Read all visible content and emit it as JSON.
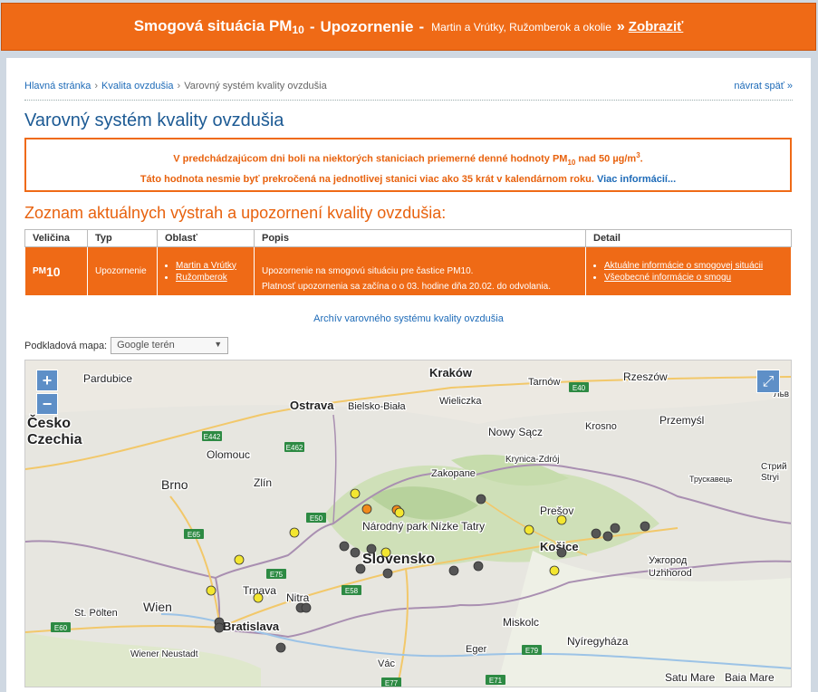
{
  "banner": {
    "title": "Smogová situácia PM",
    "title_sub": "10",
    "dash": "-",
    "type": "Upozornenie",
    "dash2": "-",
    "places": "Martin a Vrútky, Ružomberok a okolie",
    "arrow": "»",
    "link": "Zobraziť"
  },
  "breadcrumb": {
    "home": "Hlavná stránka",
    "section": "Kvalita ovzdušia",
    "current": "Varovný systém kvality ovzdušia",
    "sep": "›",
    "back": "návrat späť »"
  },
  "page_title": "Varovný systém kvality ovzdušia",
  "notice": {
    "line1_a": "V predchádzajúcom dni boli na niektorých staniciach priemerné denné hodnoty PM",
    "line1_sub": "10",
    "line1_b": " nad 50 µg/m",
    "line1_sup": "3",
    "line1_c": ".",
    "line2": "Táto hodnota nesmie byť prekročená na jednotlivej stanici viac ako 35 krát v kalendárnom roku.",
    "link": "Viac informácií..."
  },
  "list_title": "Zoznam aktuálnych výstrah a upozornení kvality ovzdušia:",
  "table": {
    "headers": [
      "Veličina",
      "Typ",
      "Oblasť",
      "Popis",
      "Detail"
    ],
    "row": {
      "pollutant": "PM",
      "pollutant_sub": "10",
      "type": "Upozornenie",
      "areas": [
        "Martin a Vrútky",
        "Ružomberok"
      ],
      "description": "Upozornenie na smogovú situáciu pre častice PM10.",
      "validity": "Platnosť upozornenia sa začína o o 03. hodine dňa 20.02. do odvolania.",
      "details": [
        "Aktuálne informácie o smogovej situácii",
        "Všeobecné informácie o smogu"
      ]
    }
  },
  "archive_link": "Archív varovného systému kvality ovzdušia",
  "map_select": {
    "label": "Podkladová mapa:",
    "value": "Google terén"
  },
  "map": {
    "zoom_in": "+",
    "zoom_out": "−",
    "fullscreen_icon": "expand-icon",
    "places": [
      "Kraków",
      "Tarnów",
      "Rzeszów",
      "Pardubice",
      "Wieliczka",
      "Česko",
      "Czechia",
      "Ostrava",
      "Bielsko-Biała",
      "Nowy Sącz",
      "Krosno",
      "Przemyśl",
      "Olomouc",
      "Krynica-Zdrój",
      "Zakopane",
      "Stryi",
      "Трускавець",
      "Стрий",
      "Brno",
      "Zlín",
      "Prešov",
      "Národný park Nízke Tatry",
      "Košice",
      "Slovensko",
      "Ужгород",
      "Uzhhorod",
      "Trnava",
      "Nitra",
      "St. Pölten",
      "Wien",
      "Bratislava",
      "Miskolc",
      "Wiener Neustadt",
      "Eger",
      "Nyíregyháza",
      "Vác",
      "Satu Mare",
      "Baia Mare",
      "Льв"
    ],
    "roads": [
      "E40",
      "E442",
      "E462",
      "E50",
      "E65",
      "E75",
      "E58",
      "E60",
      "E79",
      "E77",
      "E71"
    ]
  },
  "colors": {
    "orange": "#ef6a16",
    "link_blue": "#1e6bb8",
    "title_blue": "#1c5a94",
    "station_yellow": "#f3e630",
    "station_gray": "#555555",
    "station_orange": "#f08a1c"
  }
}
